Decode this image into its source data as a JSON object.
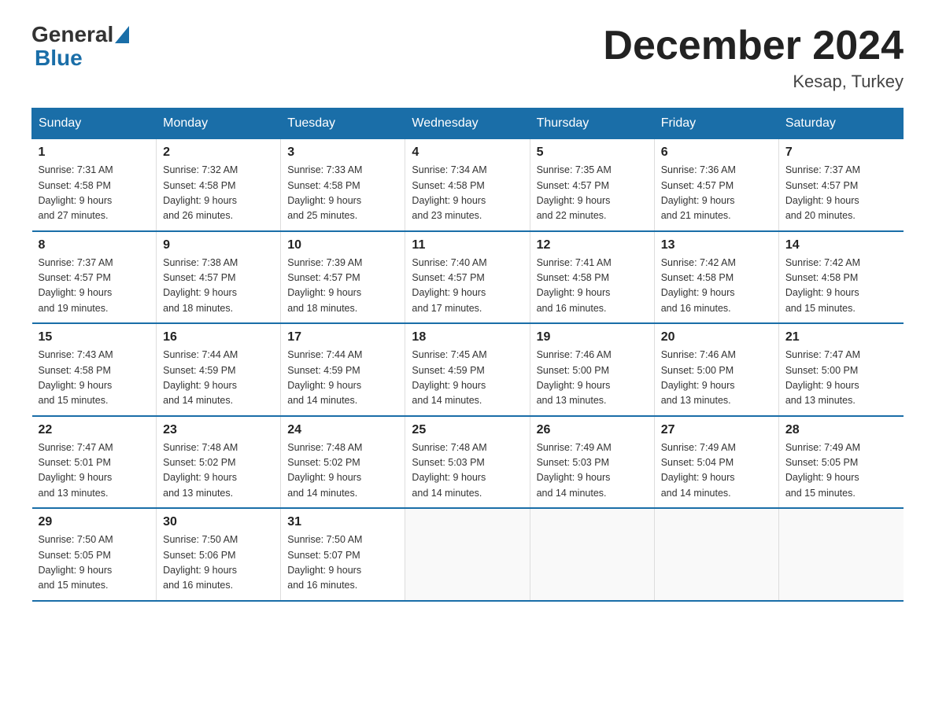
{
  "header": {
    "logo_general": "General",
    "logo_blue": "Blue",
    "title": "December 2024",
    "subtitle": "Kesap, Turkey"
  },
  "days_of_week": [
    "Sunday",
    "Monday",
    "Tuesday",
    "Wednesday",
    "Thursday",
    "Friday",
    "Saturday"
  ],
  "weeks": [
    [
      {
        "day": "1",
        "sunrise": "7:31 AM",
        "sunset": "4:58 PM",
        "daylight": "9 hours and 27 minutes."
      },
      {
        "day": "2",
        "sunrise": "7:32 AM",
        "sunset": "4:58 PM",
        "daylight": "9 hours and 26 minutes."
      },
      {
        "day": "3",
        "sunrise": "7:33 AM",
        "sunset": "4:58 PM",
        "daylight": "9 hours and 25 minutes."
      },
      {
        "day": "4",
        "sunrise": "7:34 AM",
        "sunset": "4:58 PM",
        "daylight": "9 hours and 23 minutes."
      },
      {
        "day": "5",
        "sunrise": "7:35 AM",
        "sunset": "4:57 PM",
        "daylight": "9 hours and 22 minutes."
      },
      {
        "day": "6",
        "sunrise": "7:36 AM",
        "sunset": "4:57 PM",
        "daylight": "9 hours and 21 minutes."
      },
      {
        "day": "7",
        "sunrise": "7:37 AM",
        "sunset": "4:57 PM",
        "daylight": "9 hours and 20 minutes."
      }
    ],
    [
      {
        "day": "8",
        "sunrise": "7:37 AM",
        "sunset": "4:57 PM",
        "daylight": "9 hours and 19 minutes."
      },
      {
        "day": "9",
        "sunrise": "7:38 AM",
        "sunset": "4:57 PM",
        "daylight": "9 hours and 18 minutes."
      },
      {
        "day": "10",
        "sunrise": "7:39 AM",
        "sunset": "4:57 PM",
        "daylight": "9 hours and 18 minutes."
      },
      {
        "day": "11",
        "sunrise": "7:40 AM",
        "sunset": "4:57 PM",
        "daylight": "9 hours and 17 minutes."
      },
      {
        "day": "12",
        "sunrise": "7:41 AM",
        "sunset": "4:58 PM",
        "daylight": "9 hours and 16 minutes."
      },
      {
        "day": "13",
        "sunrise": "7:42 AM",
        "sunset": "4:58 PM",
        "daylight": "9 hours and 16 minutes."
      },
      {
        "day": "14",
        "sunrise": "7:42 AM",
        "sunset": "4:58 PM",
        "daylight": "9 hours and 15 minutes."
      }
    ],
    [
      {
        "day": "15",
        "sunrise": "7:43 AM",
        "sunset": "4:58 PM",
        "daylight": "9 hours and 15 minutes."
      },
      {
        "day": "16",
        "sunrise": "7:44 AM",
        "sunset": "4:59 PM",
        "daylight": "9 hours and 14 minutes."
      },
      {
        "day": "17",
        "sunrise": "7:44 AM",
        "sunset": "4:59 PM",
        "daylight": "9 hours and 14 minutes."
      },
      {
        "day": "18",
        "sunrise": "7:45 AM",
        "sunset": "4:59 PM",
        "daylight": "9 hours and 14 minutes."
      },
      {
        "day": "19",
        "sunrise": "7:46 AM",
        "sunset": "5:00 PM",
        "daylight": "9 hours and 13 minutes."
      },
      {
        "day": "20",
        "sunrise": "7:46 AM",
        "sunset": "5:00 PM",
        "daylight": "9 hours and 13 minutes."
      },
      {
        "day": "21",
        "sunrise": "7:47 AM",
        "sunset": "5:00 PM",
        "daylight": "9 hours and 13 minutes."
      }
    ],
    [
      {
        "day": "22",
        "sunrise": "7:47 AM",
        "sunset": "5:01 PM",
        "daylight": "9 hours and 13 minutes."
      },
      {
        "day": "23",
        "sunrise": "7:48 AM",
        "sunset": "5:02 PM",
        "daylight": "9 hours and 13 minutes."
      },
      {
        "day": "24",
        "sunrise": "7:48 AM",
        "sunset": "5:02 PM",
        "daylight": "9 hours and 14 minutes."
      },
      {
        "day": "25",
        "sunrise": "7:48 AM",
        "sunset": "5:03 PM",
        "daylight": "9 hours and 14 minutes."
      },
      {
        "day": "26",
        "sunrise": "7:49 AM",
        "sunset": "5:03 PM",
        "daylight": "9 hours and 14 minutes."
      },
      {
        "day": "27",
        "sunrise": "7:49 AM",
        "sunset": "5:04 PM",
        "daylight": "9 hours and 14 minutes."
      },
      {
        "day": "28",
        "sunrise": "7:49 AM",
        "sunset": "5:05 PM",
        "daylight": "9 hours and 15 minutes."
      }
    ],
    [
      {
        "day": "29",
        "sunrise": "7:50 AM",
        "sunset": "5:05 PM",
        "daylight": "9 hours and 15 minutes."
      },
      {
        "day": "30",
        "sunrise": "7:50 AM",
        "sunset": "5:06 PM",
        "daylight": "9 hours and 16 minutes."
      },
      {
        "day": "31",
        "sunrise": "7:50 AM",
        "sunset": "5:07 PM",
        "daylight": "9 hours and 16 minutes."
      },
      null,
      null,
      null,
      null
    ]
  ],
  "labels": {
    "sunrise": "Sunrise:",
    "sunset": "Sunset:",
    "daylight": "Daylight:"
  }
}
